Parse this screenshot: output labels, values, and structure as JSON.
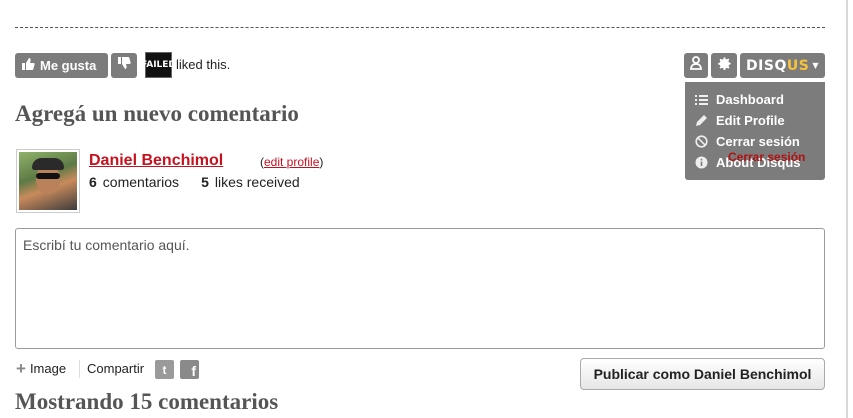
{
  "like_bar": {
    "like_label": "Me gusta",
    "liker_badge_text": "FAILED",
    "liked_text": "liked this."
  },
  "disqus_toolbar": {
    "brand_main": "DISQ",
    "brand_accent": "US",
    "accent_color": "#f6c23a",
    "menu": [
      {
        "icon": "list-icon",
        "label": "Dashboard"
      },
      {
        "icon": "pencil-icon",
        "label": "Edit Profile"
      },
      {
        "icon": "no-entry-icon",
        "label": "Cerrar sesión"
      },
      {
        "icon": "info-icon",
        "label": "About Disqus"
      }
    ],
    "overlap_text": "Cerrar sesión"
  },
  "add_comment": {
    "title": "Agregá un nuevo comentario",
    "user_name": "Daniel Benchimol",
    "edit_profile_label": "edit profile",
    "comments_count": "6",
    "comments_label": "comentarios",
    "likes_count": "5",
    "likes_label": "likes received",
    "textarea_placeholder": "Escribí tu comentario aquí.",
    "image_label": "Image",
    "share_label": "Compartir",
    "publish_label": "Publicar como Daniel Benchimol"
  },
  "comments_section": {
    "title": "Mostrando 15 comentarios"
  },
  "colors": {
    "toolbar_gray": "#7c7c7c",
    "link_red": "#c6121f",
    "title_gray": "#555555"
  }
}
